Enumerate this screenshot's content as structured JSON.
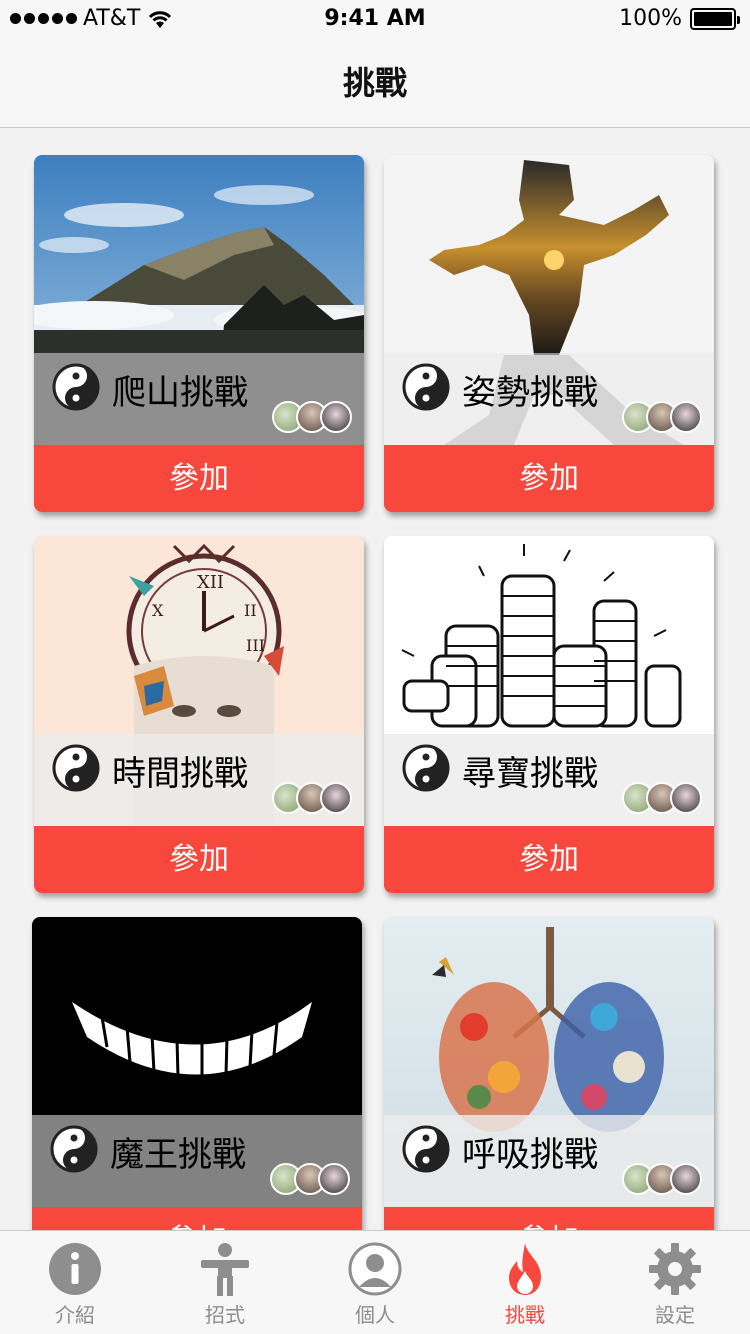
{
  "status_bar": {
    "carrier": "AT&T",
    "time": "9:41 AM",
    "battery_percent": "100%"
  },
  "nav": {
    "title": "挑戰"
  },
  "challenges": [
    {
      "title": "爬山挑戰",
      "button": "參加",
      "image": "mountain",
      "overlay": "gray"
    },
    {
      "title": "姿勢挑戰",
      "button": "參加",
      "image": "martial-arts-silhouette",
      "overlay": "gray"
    },
    {
      "title": "時間挑戰",
      "button": "參加",
      "image": "clock-face",
      "overlay": "light"
    },
    {
      "title": "尋寶挑戰",
      "button": "參加",
      "image": "coin-stacks",
      "overlay": "light"
    },
    {
      "title": "魔王挑戰",
      "button": "參加",
      "image": "teeth-grin",
      "overlay": "gray"
    },
    {
      "title": "呼吸挑戰",
      "button": "參加",
      "image": "flower-lungs",
      "overlay": "light"
    }
  ],
  "tab_bar": {
    "tabs": [
      {
        "label": "介紹",
        "icon": "info-icon",
        "active": false
      },
      {
        "label": "招式",
        "icon": "person-icon",
        "active": false
      },
      {
        "label": "個人",
        "icon": "profile-icon",
        "active": false
      },
      {
        "label": "挑戰",
        "icon": "flame-icon",
        "active": true
      },
      {
        "label": "設定",
        "icon": "gear-icon",
        "active": false
      }
    ]
  },
  "colors": {
    "accent": "#f8473c",
    "tab_inactive": "#8e8e8e",
    "background": "#f2f2f2"
  }
}
